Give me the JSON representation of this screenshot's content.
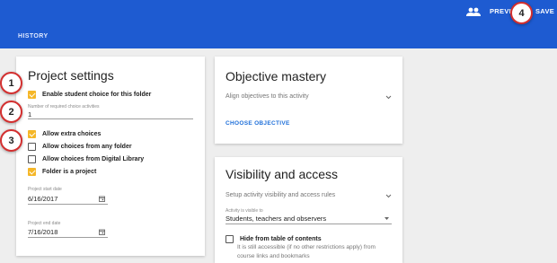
{
  "header": {
    "section": "HISTORY",
    "preview_label": "PREVI",
    "save_label": "SAVE",
    "colors": {
      "bar": "#1e5bd1"
    }
  },
  "markers": [
    "1",
    "2",
    "3",
    "4"
  ],
  "project_settings": {
    "title": "Project settings",
    "enable_choice_label": "Enable student choice for this folder",
    "enable_choice_checked": true,
    "required_label": "Number of required choice activities",
    "required_value": "1",
    "options": [
      {
        "label": "Allow extra choices",
        "checked": true
      },
      {
        "label": "Allow choices from any folder",
        "checked": false
      },
      {
        "label": "Allow choices from Digital Library",
        "checked": false
      },
      {
        "label": "Folder is a project",
        "checked": true
      }
    ],
    "start_label": "Project start date",
    "start_value": "6/16/2017",
    "end_label": "Project end date",
    "end_value": "7/16/2018"
  },
  "objective": {
    "title": "Objective mastery",
    "align_text": "Align objectives to this activity",
    "choose_label": "CHOOSE OBJECTIVE"
  },
  "visibility": {
    "title": "Visibility and access",
    "setup_text": "Setup activity visibility and access rules",
    "visible_to_label": "Activity is visible to",
    "visible_to_value": "Students, teachers and observers",
    "hide_label": "Hide from table of contents",
    "hide_checked": false,
    "hide_desc_1": "It is still accessible (if no other restrictions apply) from",
    "hide_desc_2": "course links and bookmarks"
  },
  "icons": [
    "people-icon",
    "calendar-icon",
    "chevron-down-icon",
    "dropdown-arrow-icon"
  ]
}
